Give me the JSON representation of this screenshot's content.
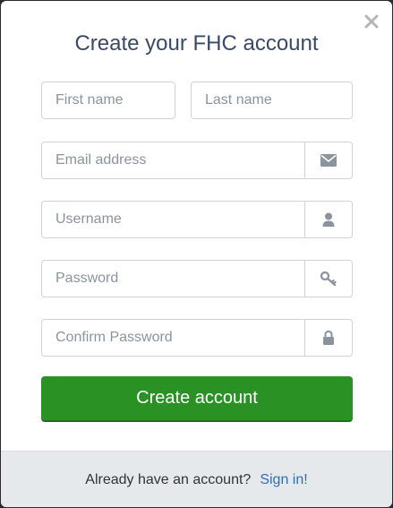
{
  "dialog": {
    "title": "Create your FHC account",
    "close_icon": "close-icon"
  },
  "form": {
    "first_name": {
      "placeholder": "First name",
      "value": ""
    },
    "last_name": {
      "placeholder": "Last name",
      "value": ""
    },
    "email": {
      "placeholder": "Email address",
      "value": "",
      "icon": "envelope-icon"
    },
    "username": {
      "placeholder": "Username",
      "value": "",
      "icon": "user-icon"
    },
    "password": {
      "placeholder": "Password",
      "value": "",
      "icon": "key-icon"
    },
    "confirm_password": {
      "placeholder": "Confirm Password",
      "value": "",
      "icon": "lock-icon"
    },
    "submit_label": "Create account"
  },
  "footer": {
    "prompt": "Already have an account?",
    "link_label": "Sign in!"
  },
  "colors": {
    "primary_button": "#2a9124",
    "link": "#2d6fb6",
    "title": "#3a4a66"
  }
}
